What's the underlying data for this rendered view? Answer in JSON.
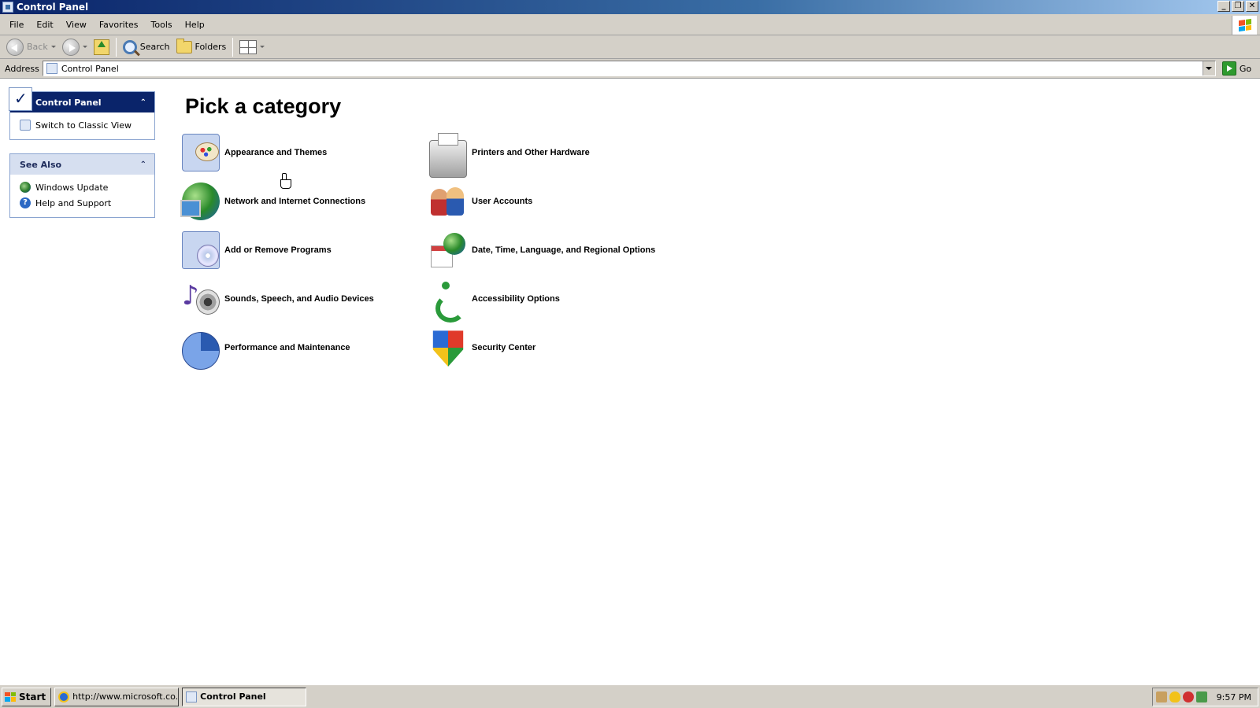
{
  "window": {
    "title": "Control Panel",
    "buttons": {
      "minimize": "_",
      "restore": "❐",
      "close": "✕"
    }
  },
  "menu": [
    "File",
    "Edit",
    "View",
    "Favorites",
    "Tools",
    "Help"
  ],
  "toolbar": {
    "back": "Back",
    "search": "Search",
    "folders": "Folders"
  },
  "address": {
    "label": "Address",
    "value": "Control Panel",
    "go": "Go"
  },
  "taskpane": {
    "control_panel": {
      "title": "Control Panel",
      "links": [
        "Switch to Classic View"
      ]
    },
    "see_also": {
      "title": "See Also",
      "links": [
        "Windows Update",
        "Help and Support"
      ]
    }
  },
  "main": {
    "title": "Pick a category",
    "categories": [
      {
        "label": "Appearance and Themes",
        "icon": "appearance-themes-icon"
      },
      {
        "label": "Printers and Other Hardware",
        "icon": "printer-icon"
      },
      {
        "label": "Network and Internet Connections",
        "icon": "network-globe-icon"
      },
      {
        "label": "User Accounts",
        "icon": "user-accounts-icon"
      },
      {
        "label": "Add or Remove Programs",
        "icon": "add-remove-programs-icon"
      },
      {
        "label": "Date, Time, Language, and Regional Options",
        "icon": "date-time-globe-icon"
      },
      {
        "label": "Sounds, Speech, and Audio Devices",
        "icon": "sounds-speaker-icon"
      },
      {
        "label": "Accessibility Options",
        "icon": "accessibility-icon"
      },
      {
        "label": "Performance and Maintenance",
        "icon": "performance-chart-icon"
      },
      {
        "label": "Security Center",
        "icon": "security-shield-icon"
      }
    ]
  },
  "taskbar": {
    "start": "Start",
    "tasks": [
      "http://www.microsoft.co...",
      "Control Panel"
    ],
    "clock": "9:57 PM"
  }
}
